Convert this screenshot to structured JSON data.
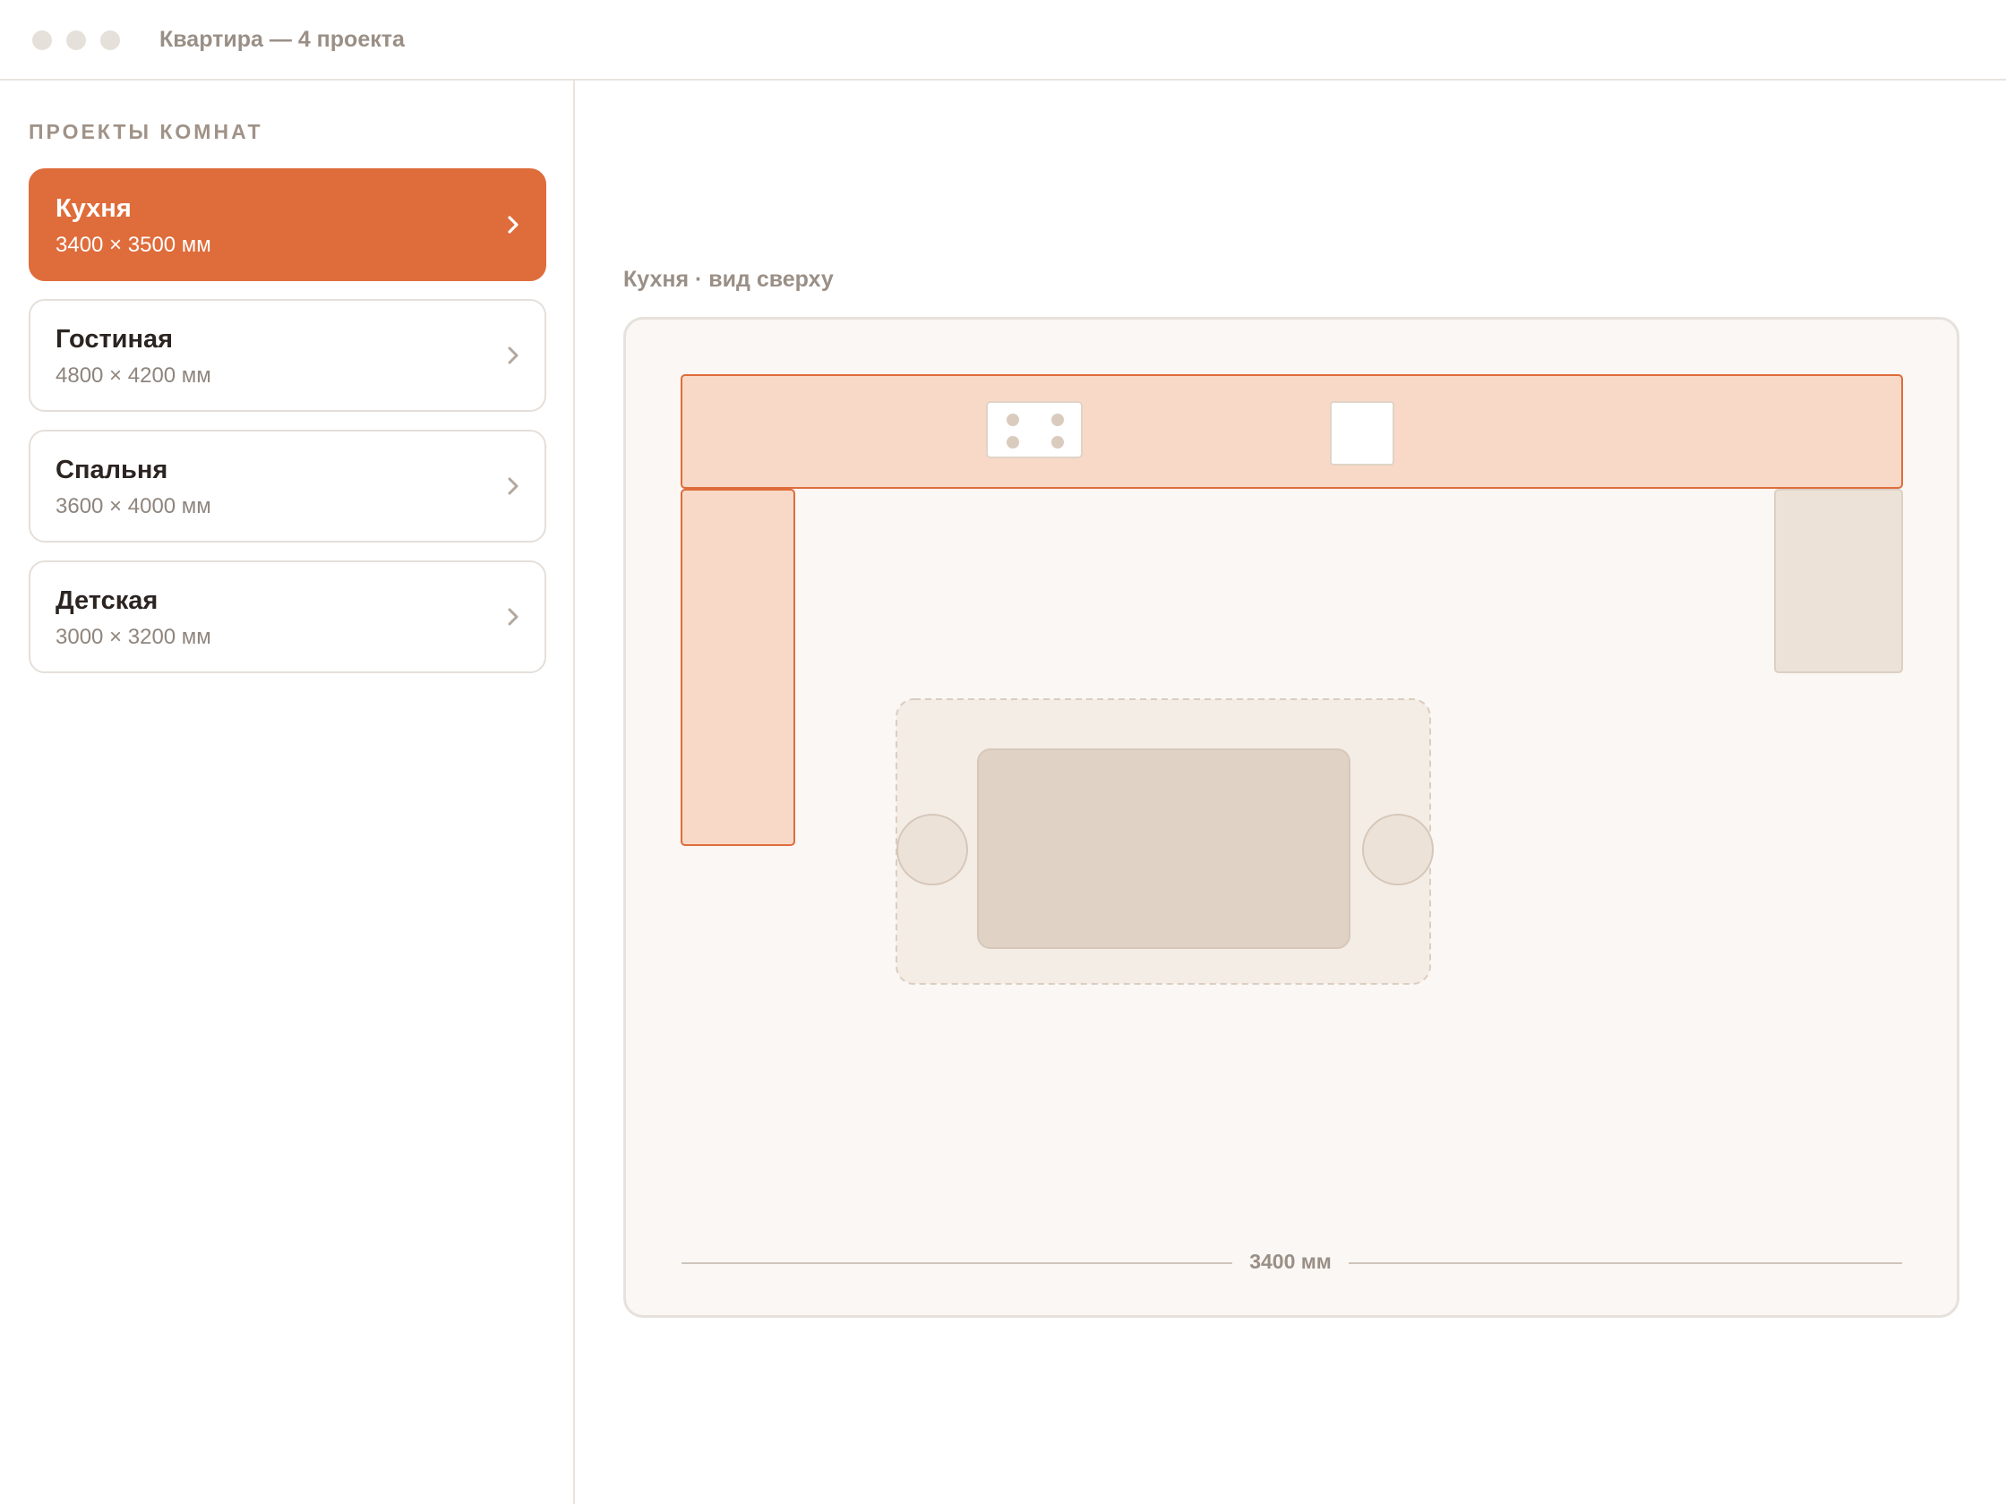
{
  "window": {
    "title": "Квартира — 4 проекта"
  },
  "sidebar": {
    "heading": "ПРОЕКТЫ КОМНАТ",
    "rooms": [
      {
        "name": "Кухня",
        "size": "3400 × 3500 мм",
        "active": true
      },
      {
        "name": "Гостиная",
        "size": "4800 × 4200 мм",
        "active": false
      },
      {
        "name": "Спальня",
        "size": "3600 × 4000 мм",
        "active": false
      },
      {
        "name": "Детская",
        "size": "3000 × 3200 мм",
        "active": false
      }
    ]
  },
  "plan": {
    "title": "Кухня · вид сверху",
    "width_label": "3400 мм"
  },
  "colors": {
    "accent": "#df6c3b",
    "cabinet_fill": "#f8d9c7",
    "cabinet_stroke": "#df6c3b",
    "fridge_fill": "#ece2d8",
    "table_fill": "#e0d3c6",
    "chair_fill": "#ece2d8",
    "zone_fill": "#f4ede6"
  },
  "icons": {
    "room_arrow": "chevron-right-icon",
    "hob": "hob-icon",
    "sink": "sink-icon"
  }
}
